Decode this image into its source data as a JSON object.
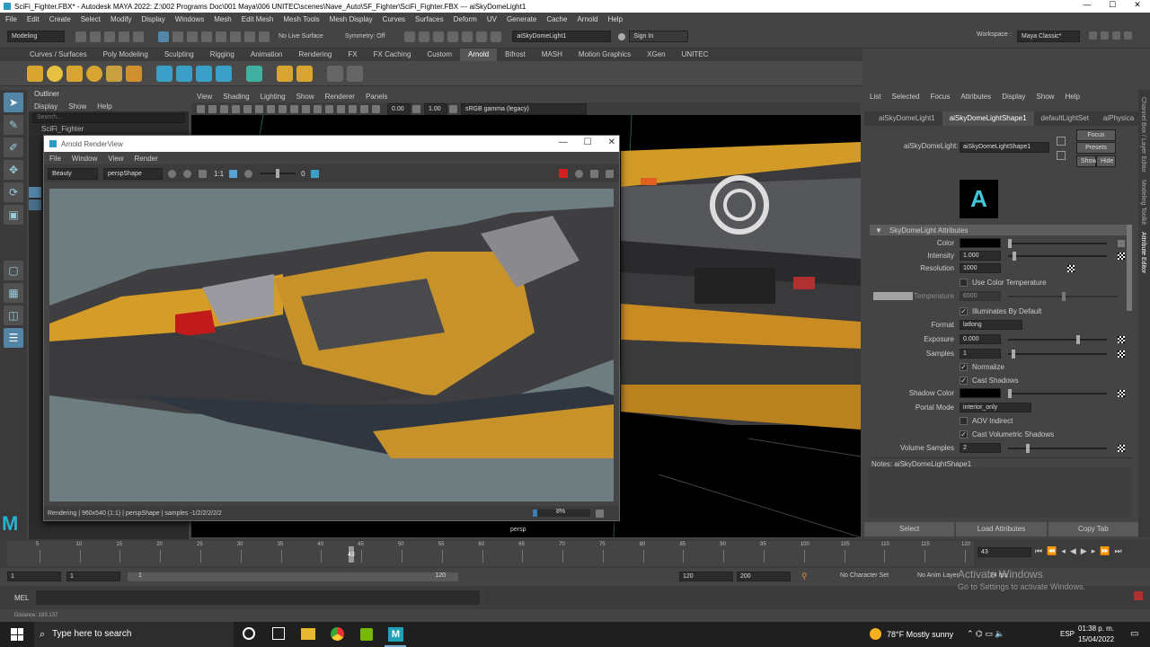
{
  "window": {
    "title": "SciFi_Fighter.FBX* - Autodesk MAYA 2022: Z:\\002 Programs Doc\\001 Maya\\006 UNITEC\\scenes\\Nave_Auto\\SF_Fighter\\SciFi_Fighter.FBX  ---  aiSkyDomeLight1",
    "minimize": "—",
    "maximize": "☐",
    "close": "✕"
  },
  "menubar": [
    "File",
    "Edit",
    "Create",
    "Select",
    "Modify",
    "Display",
    "Windows",
    "Mesh",
    "Edit Mesh",
    "Mesh Tools",
    "Mesh Display",
    "Curves",
    "Surfaces",
    "Deform",
    "UV",
    "Generate",
    "Cache",
    "Arnold",
    "Help"
  ],
  "statusline": {
    "mode": "Modeling",
    "live_surface": "No Live Surface",
    "symmetry": "Symmetry: Off",
    "selected_object": "aiSkyDomeLight1",
    "sign_in": "Sign In",
    "workspace_label": "Workspace :",
    "workspace": "Maya Classic*"
  },
  "shelf_tabs": [
    "Curves / Surfaces",
    "Poly Modeling",
    "Sculpting",
    "Rigging",
    "Animation",
    "Rendering",
    "FX",
    "FX Caching",
    "Custom",
    "Arnold",
    "Bifrost",
    "MASH",
    "Motion Graphics",
    "XGen",
    "UNITEC"
  ],
  "shelf_active_tab": "Arnold",
  "outliner": {
    "title": "Outliner",
    "menu": [
      "Display",
      "Show",
      "Help"
    ],
    "search_placeholder": "Search...",
    "items": [
      "SciFi_Fighter"
    ]
  },
  "viewport": {
    "menu": [
      "View",
      "Shading",
      "Lighting",
      "Show",
      "Renderer",
      "Panels"
    ],
    "exposure": "0.00",
    "gamma": "1.00",
    "color_space": "sRGB gamma (legacy)",
    "camera_label": "persp"
  },
  "renderview": {
    "title": "Arnold RenderView",
    "menu": [
      "File",
      "Window",
      "View",
      "Render"
    ],
    "aov": "Beauty",
    "camera": "perspShape",
    "ratio": "1:1",
    "exposure_value": "0",
    "status": "Rendering | 960x540 (1:1) | perspShape | samples -1/2/2/2/2/2",
    "progress": "8%"
  },
  "attribute_editor": {
    "menu": [
      "List",
      "Selected",
      "Focus",
      "Attributes",
      "Display",
      "Show",
      "Help"
    ],
    "tabs": [
      "aiSkyDomeLight1",
      "aiSkyDomeLightShape1",
      "defaultLightSet",
      "aiPhysica"
    ],
    "active_tab": "aiSkyDomeLightShape1",
    "node_label": "aiSkyDomeLight:",
    "node_name": "aiSkyDomeLightShape1",
    "buttons": {
      "focus": "Focus",
      "presets": "Presets",
      "show": "Show",
      "hide": "Hide"
    },
    "section": "SkyDomeLight Attributes",
    "attributes": {
      "color": "Color",
      "intensity_label": "Intensity",
      "intensity": "1.000",
      "resolution_label": "Resolution",
      "resolution": "1000",
      "use_color_temperature": "Use Color Temperature",
      "temperature_label": "Temperature",
      "temperature": "6500",
      "illuminates_by_default": "Illuminates By Default",
      "format_label": "Format",
      "format": "latlong",
      "exposure_label": "Exposure",
      "exposure": "0.000",
      "samples_label": "Samples",
      "samples": "1",
      "normalize": "Normalize",
      "cast_shadows": "Cast Shadows",
      "shadow_color": "Shadow Color",
      "portal_mode_label": "Portal Mode",
      "portal_mode": "interior_only",
      "aov_indirect": "AOV Indirect",
      "cast_volumetric_shadows": "Cast Volumetric Shadows",
      "volume_samples_label": "Volume Samples",
      "volume_samples": "2"
    },
    "notes": "Notes:  aiSkyDomeLightShape1",
    "bottom_buttons": [
      "Select",
      "Load Attributes",
      "Copy Tab"
    ]
  },
  "side_tabs": [
    "Channel Box / Layer Editor",
    "Modeling Toolkit",
    "Attribute Editor"
  ],
  "timeline": {
    "ticks": [
      "5",
      "10",
      "15",
      "20",
      "25",
      "30",
      "35",
      "40",
      "45",
      "50",
      "55",
      "60",
      "65",
      "70",
      "75",
      "80",
      "85",
      "90",
      "95",
      "100",
      "105",
      "110",
      "115",
      "120"
    ],
    "current_frame": "43",
    "current_frame_field": "43"
  },
  "range": {
    "start": "1",
    "start_inner": "1",
    "range_start": "1",
    "range_end": "120",
    "end_inner": "120",
    "end": "200",
    "character_set": "No Character Set",
    "anim_layer": "No Anim Layer",
    "fps": "24 fps"
  },
  "cmdline": {
    "label": "MEL"
  },
  "helpline": "Distance:      183.137",
  "watermark": {
    "line1": "Activate Windows",
    "line2": "Go to Settings to activate Windows."
  },
  "taskbar": {
    "search": "Type here to search",
    "weather": "78°F  Mostly sunny",
    "lang": "ESP",
    "time": "01:38 p. m.",
    "date": "15/04/2022"
  }
}
